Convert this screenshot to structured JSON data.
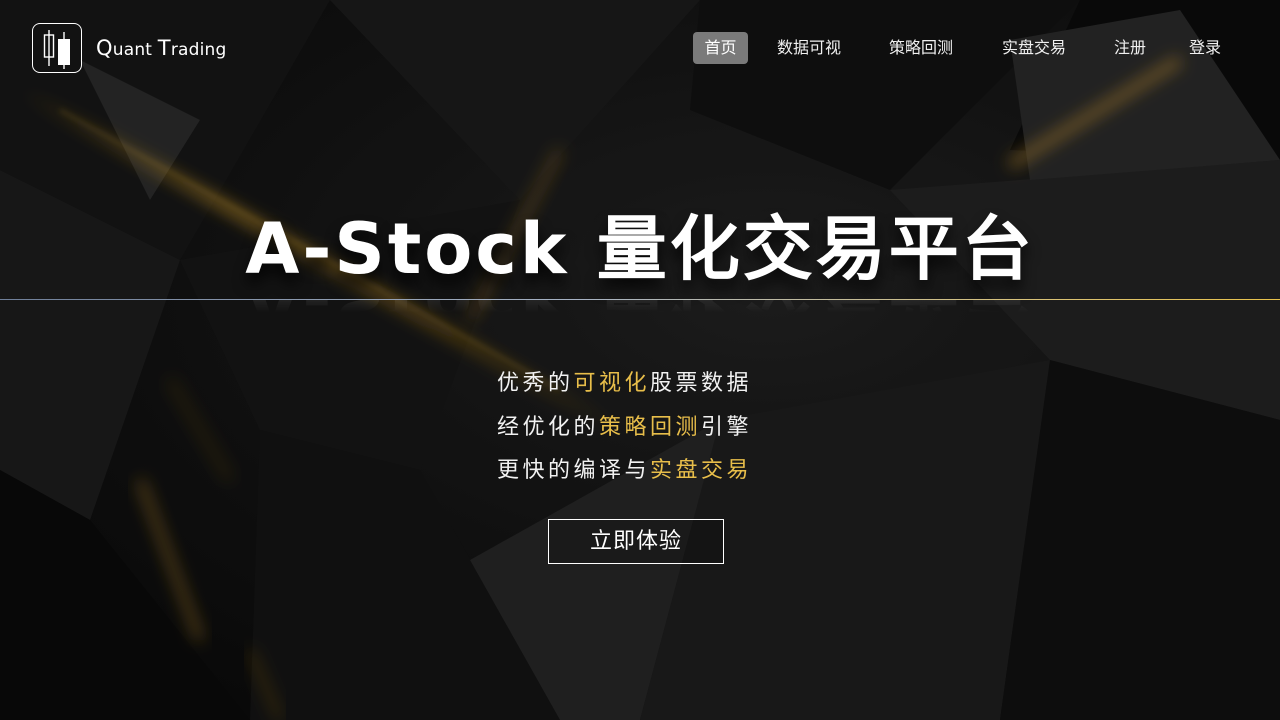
{
  "brand": {
    "name_first": "Q",
    "name_mid": "uant ",
    "name_cap2": "T",
    "name_rest": "rading",
    "logo_icon": "candlestick-icon"
  },
  "nav": {
    "items": [
      {
        "label": "首页",
        "active": true
      },
      {
        "label": "数据可视",
        "active": false
      },
      {
        "label": "策略回测",
        "active": false
      },
      {
        "label": "实盘交易",
        "active": false
      },
      {
        "label": "注册",
        "active": false
      },
      {
        "label": "登录",
        "active": false
      }
    ]
  },
  "hero": {
    "title": "A-Stock 量化交易平台",
    "taglines": [
      {
        "pre": "优秀的",
        "highlight": "可视化",
        "post": "股票数据"
      },
      {
        "pre": "经优化的",
        "highlight": "策略回测",
        "post": "引擎"
      },
      {
        "pre": "更快的编译与",
        "highlight": "实盘交易",
        "post": ""
      }
    ],
    "cta_label": "立即体验"
  },
  "colors": {
    "accent": "#e8be4a",
    "active_nav_bg": "#7a7a7a",
    "background": "#0d0d0d"
  }
}
